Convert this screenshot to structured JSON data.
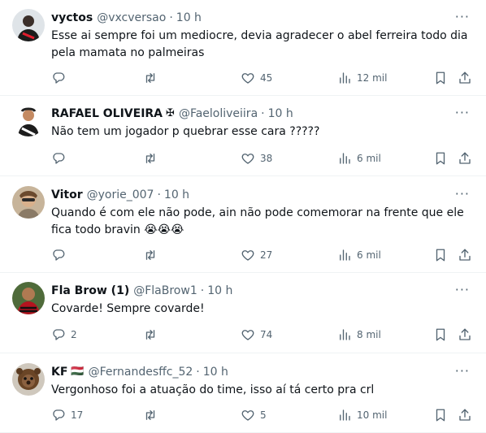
{
  "replies": [
    {
      "name": "vyctos",
      "badge": "",
      "handle": "@vxcversao",
      "time": "10 h",
      "text": "Esse ai sempre foi um mediocre, devia agradecer o abel ferreira todo dia pela mamata no palmeiras",
      "replies_count": "",
      "retweets_count": "",
      "likes_count": "45",
      "views_count": "12 mil"
    },
    {
      "name": "RAFAEL OLIVEIRA",
      "badge": "✠",
      "handle": "@Faeloliveiira",
      "time": "10 h",
      "text": "Não tem um jogador p quebrar esse cara ?????",
      "replies_count": "",
      "retweets_count": "",
      "likes_count": "38",
      "views_count": "6 mil"
    },
    {
      "name": "Vitor",
      "badge": "",
      "handle": "@yorie_007",
      "time": "10 h",
      "text": "Quando é com ele não pode, ain não pode comemorar na frente que ele fica todo bravin 😭😭😭",
      "replies_count": "",
      "retweets_count": "",
      "likes_count": "27",
      "views_count": "6 mil"
    },
    {
      "name": "Fla Brow (1)",
      "badge": "",
      "handle": "@FlaBrow1",
      "time": "10 h",
      "text": "Covarde! Sempre covarde!",
      "replies_count": "2",
      "retweets_count": "",
      "likes_count": "74",
      "views_count": "8 mil"
    },
    {
      "name": "KF",
      "badge": "🇭🇺",
      "handle": "@Fernandesffc_52",
      "time": "10 h",
      "text": "Vergonhoso foi a atuação do time, isso aí tá certo pra crl",
      "replies_count": "17",
      "retweets_count": "",
      "likes_count": "5",
      "views_count": "10 mil"
    }
  ],
  "icons": {
    "reply": "reply-icon",
    "retweet": "retweet-icon",
    "like": "heart-icon",
    "views": "views-chart-icon",
    "bookmark": "bookmark-icon",
    "share": "share-icon",
    "more": "more-icon"
  },
  "colors": {
    "text": "#0f1419",
    "secondary": "#536471",
    "divider": "#eff3f4"
  }
}
